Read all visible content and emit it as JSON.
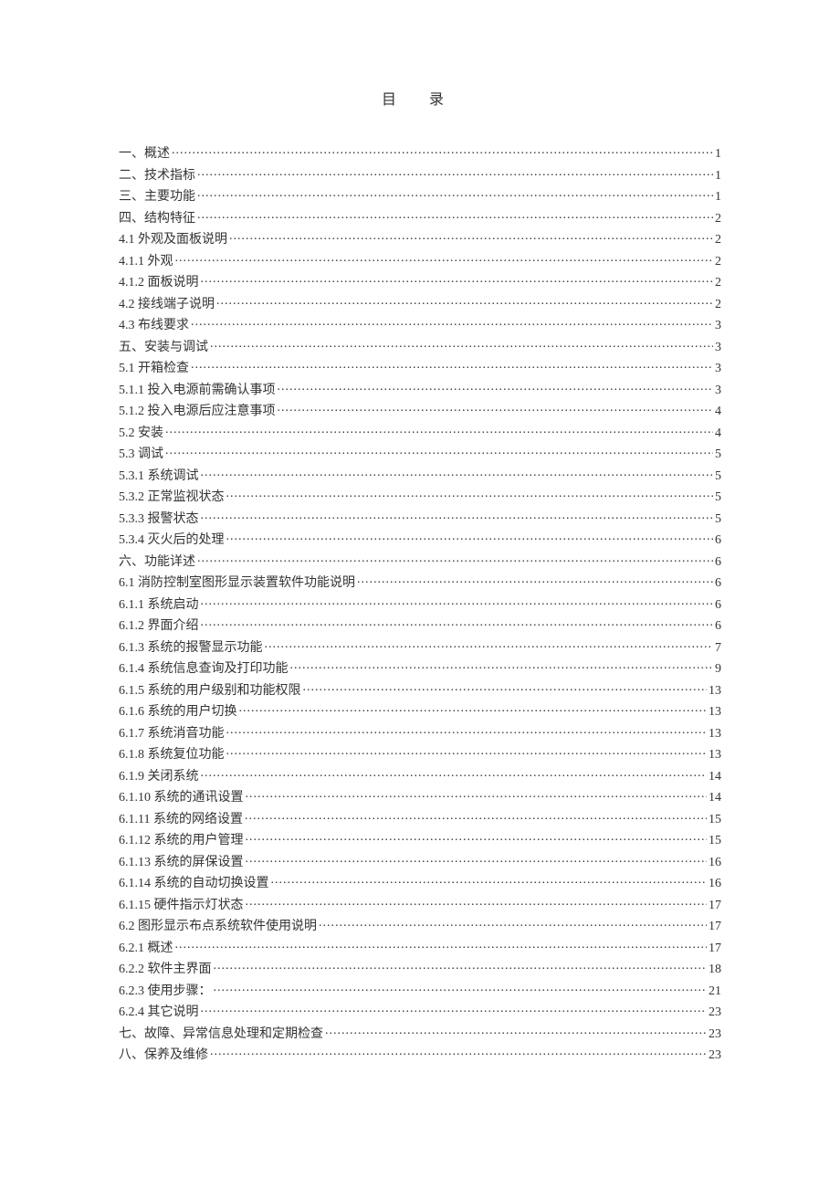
{
  "title": "目 录",
  "entries": [
    {
      "label": "一、概述",
      "page": "1"
    },
    {
      "label": "二、技术指标",
      "page": "1"
    },
    {
      "label": "三、主要功能",
      "page": "1"
    },
    {
      "label": "四、结构特征",
      "page": "2"
    },
    {
      "label": "4.1 外观及面板说明",
      "page": "2"
    },
    {
      "label": "4.1.1 外观",
      "page": "2"
    },
    {
      "label": "4.1.2 面板说明",
      "page": "2"
    },
    {
      "label": "4.2 接线端子说明",
      "page": "2"
    },
    {
      "label": "4.3 布线要求",
      "page": "3"
    },
    {
      "label": "五、安装与调试",
      "page": "3"
    },
    {
      "label": "5.1 开箱检查",
      "page": "3"
    },
    {
      "label": "5.1.1 投入电源前需确认事项",
      "page": "3"
    },
    {
      "label": "5.1.2 投入电源后应注意事项",
      "page": "4"
    },
    {
      "label": "5.2 安装",
      "page": "4"
    },
    {
      "label": "5.3 调试",
      "page": "5"
    },
    {
      "label": "5.3.1 系统调试",
      "page": "5"
    },
    {
      "label": "5.3.2 正常监视状态",
      "page": "5"
    },
    {
      "label": "5.3.3 报警状态",
      "page": "5"
    },
    {
      "label": "5.3.4 灭火后的处理",
      "page": "6"
    },
    {
      "label": "六、功能详述",
      "page": "6"
    },
    {
      "label": "6.1 消防控制室图形显示装置软件功能说明",
      "page": "6"
    },
    {
      "label": "6.1.1 系统启动",
      "page": "6"
    },
    {
      "label": "6.1.2 界面介绍",
      "page": "6"
    },
    {
      "label": "6.1.3 系统的报警显示功能",
      "page": "7"
    },
    {
      "label": "6.1.4 系统信息查询及打印功能",
      "page": "9"
    },
    {
      "label": "6.1.5 系统的用户级别和功能权限",
      "page": "13"
    },
    {
      "label": "6.1.6 系统的用户切换",
      "page": "13"
    },
    {
      "label": "6.1.7 系统消音功能",
      "page": "13"
    },
    {
      "label": "6.1.8 系统复位功能",
      "page": "13"
    },
    {
      "label": "6.1.9 关闭系统",
      "page": "14"
    },
    {
      "label": "6.1.10 系统的通讯设置",
      "page": "14"
    },
    {
      "label": "6.1.11 系统的网络设置",
      "page": "15"
    },
    {
      "label": "6.1.12 系统的用户管理",
      "page": "15"
    },
    {
      "label": "6.1.13 系统的屏保设置",
      "page": "16"
    },
    {
      "label": "6.1.14 系统的自动切换设置",
      "page": "16"
    },
    {
      "label": "6.1.15 硬件指示灯状态",
      "page": "17"
    },
    {
      "label": "6.2 图形显示布点系统软件使用说明",
      "page": "17"
    },
    {
      "label": "6.2.1 概述",
      "page": "17"
    },
    {
      "label": "6.2.2 软件主界面",
      "page": "18"
    },
    {
      "label": "6.2.3 使用步骤：",
      "page": "21"
    },
    {
      "label": "6.2.4 其它说明",
      "page": "23"
    },
    {
      "label": "七、故障、异常信息处理和定期检查",
      "page": "23"
    },
    {
      "label": "八、保养及维修",
      "page": "23"
    }
  ]
}
